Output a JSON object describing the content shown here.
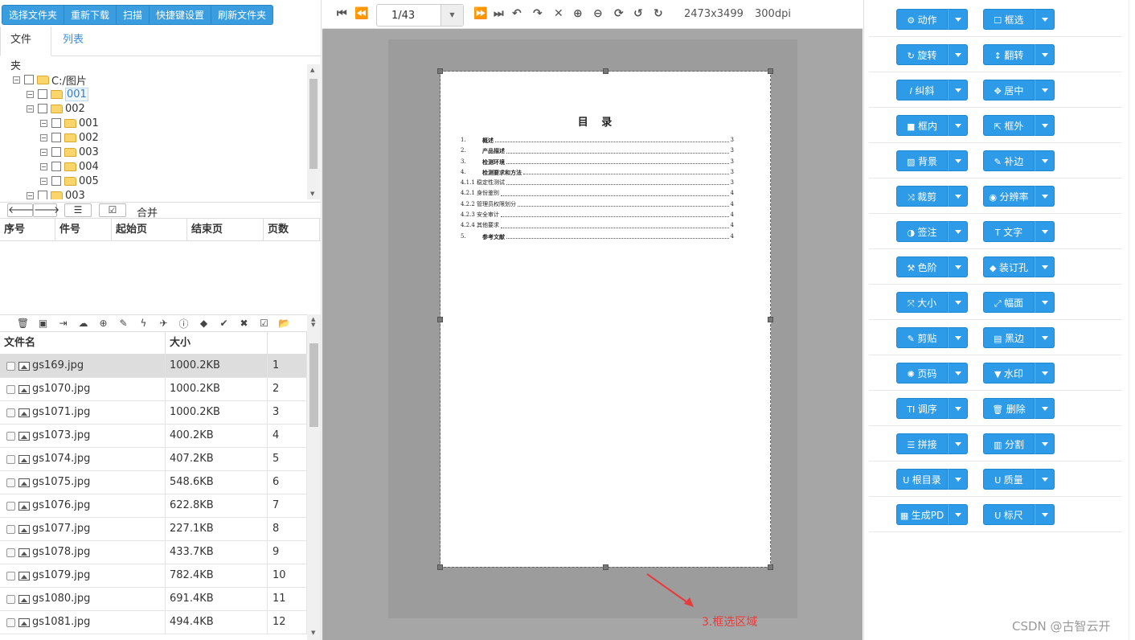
{
  "top_buttons": [
    "选择文件夹",
    "重新下载",
    "扫描",
    "快捷键设置",
    "刷新文件夹"
  ],
  "tabs": [
    "文件夹",
    "列表"
  ],
  "tree": [
    {
      "label": "C:/图片",
      "level": 0
    },
    {
      "label": "001",
      "level": 1,
      "selected": true
    },
    {
      "label": "002",
      "level": 1
    },
    {
      "label": "001",
      "level": 2
    },
    {
      "label": "002",
      "level": 2
    },
    {
      "label": "003",
      "level": 2
    },
    {
      "label": "004",
      "level": 2
    },
    {
      "label": "005",
      "level": 2
    },
    {
      "label": "003",
      "level": 1
    }
  ],
  "nav": {
    "merge_label": "合并"
  },
  "doc_table_headers": [
    "序号",
    "件号",
    "起始页",
    "结束页",
    "页数"
  ],
  "file_headers": [
    "文件名",
    "大小"
  ],
  "files": [
    {
      "name": "gs169.jpg",
      "size": "1000.2KB",
      "index": "1"
    },
    {
      "name": "gs1070.jpg",
      "size": "1000.2KB",
      "index": "2"
    },
    {
      "name": "gs1071.jpg",
      "size": "1000.2KB",
      "index": "3"
    },
    {
      "name": "gs1073.jpg",
      "size": "400.2KB",
      "index": "4"
    },
    {
      "name": "gs1074.jpg",
      "size": "407.2KB",
      "index": "5"
    },
    {
      "name": "gs1075.jpg",
      "size": "548.6KB",
      "index": "6"
    },
    {
      "name": "gs1076.jpg",
      "size": "622.8KB",
      "index": "7"
    },
    {
      "name": "gs1077.jpg",
      "size": "227.1KB",
      "index": "8"
    },
    {
      "name": "gs1078.jpg",
      "size": "433.7KB",
      "index": "9"
    },
    {
      "name": "gs1079.jpg",
      "size": "782.4KB",
      "index": "10"
    },
    {
      "name": "gs1080.jpg",
      "size": "691.4KB",
      "index": "11"
    },
    {
      "name": "gs1081.jpg",
      "size": "494.4KB",
      "index": "12"
    }
  ],
  "viewer": {
    "page": "1/43",
    "dimensions": "2473x3499",
    "dpi": "300dpi"
  },
  "document": {
    "title": "目  录",
    "entries": [
      {
        "num": "1.",
        "text": "概述",
        "page": "3"
      },
      {
        "num": "2.",
        "text": "产品描述",
        "page": "3"
      },
      {
        "num": "3.",
        "text": "检测环境",
        "page": "3"
      },
      {
        "num": "4.",
        "text": "检测要求和方法",
        "page": "3"
      },
      {
        "num": "",
        "text": "4.1.1 稳定性测试",
        "page": "3"
      },
      {
        "num": "",
        "text": "4.2.1 身份鉴别",
        "page": "4"
      },
      {
        "num": "",
        "text": "4.2.2 管理员权限划分",
        "page": "4"
      },
      {
        "num": "",
        "text": "4.2.3 安全审计",
        "page": "4"
      },
      {
        "num": "",
        "text": "4.2.4 其他要求",
        "page": "4"
      },
      {
        "num": "5.",
        "text": "参考文献",
        "page": "4"
      }
    ]
  },
  "annotation": "3.框选区域",
  "watermark": "CSDN @古智云开",
  "right_buttons": [
    [
      "动作",
      "框选"
    ],
    [
      "旋转",
      "翻转"
    ],
    [
      "纠斜",
      "居中"
    ],
    [
      "框内",
      "框外"
    ],
    [
      "背景",
      "补边"
    ],
    [
      "裁剪",
      "分辨率"
    ],
    [
      "签注",
      "文字"
    ],
    [
      "色阶",
      "装订孔"
    ],
    [
      "大小",
      "幅面"
    ],
    [
      "剪贴",
      "黑边"
    ],
    [
      "页码",
      "水印"
    ],
    [
      "调序",
      "删除"
    ],
    [
      "拼接",
      "分割"
    ],
    [
      "根目录",
      "质量"
    ],
    [
      "生成PD",
      "标尺"
    ]
  ],
  "colors": {
    "accent": "#2e9be8",
    "annotation": "#e83b3b"
  }
}
